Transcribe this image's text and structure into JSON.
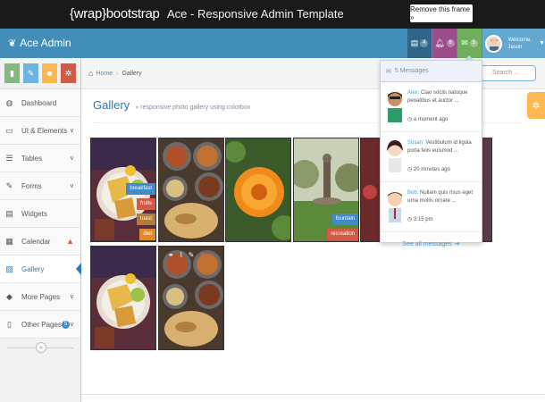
{
  "wrap_banner": {
    "logo": "{wrap}bootstrap",
    "title": "Ace - Responsive Admin Template",
    "remove_label": "Remove this frame »"
  },
  "navbar": {
    "brand": "Ace Admin",
    "tasks_count": "4",
    "notifications_count": "8",
    "messages_count": "5",
    "welcome": "Welcome,",
    "username": "Jason",
    "colors": {
      "bar": "#438eb9",
      "tasks": "#2e6589",
      "notifications": "#9b4d8c",
      "messages": "#6fae5c",
      "user": "#62a8d1"
    }
  },
  "shortcuts": [
    {
      "icon": "signal-icon",
      "color": "#87b87f"
    },
    {
      "icon": "pencil-icon",
      "color": "#6fb3e0"
    },
    {
      "icon": "users-icon",
      "color": "#ffb752"
    },
    {
      "icon": "cogs-icon",
      "color": "#d15b47"
    }
  ],
  "sidebar": {
    "items": [
      {
        "label": "Dashboard"
      },
      {
        "label": "UI & Elements"
      },
      {
        "label": "Tables"
      },
      {
        "label": "Forms"
      },
      {
        "label": "Widgets"
      },
      {
        "label": "Calendar"
      },
      {
        "label": "Gallery"
      },
      {
        "label": "More Pages"
      },
      {
        "label": "Other Pages",
        "badge": "5"
      }
    ]
  },
  "breadcrumb": {
    "home": "Home",
    "current": "Gallery",
    "search_placeholder": "Search ..."
  },
  "page": {
    "title": "Gallery",
    "subtitle": "» responsive photo gallery using colorbox"
  },
  "gallery": {
    "tags": {
      "t1": "breakfast",
      "t2": "fruits",
      "t3": "toast",
      "t4": "diet",
      "t5": "fountain",
      "t6": "recreation"
    }
  },
  "messages": {
    "header": "5 Messages",
    "items": [
      {
        "name": "Alex:",
        "text": "Ciao sociis natoque penatibus et auctor ...",
        "time": "a moment ago"
      },
      {
        "name": "Susan:",
        "text": "Vestibulum id ligula porta felis euismod ...",
        "time": "20 minutes ago"
      },
      {
        "name": "Bob:",
        "text": "Nullam quis risus eget urna mollis ornare ...",
        "time": "3:15 pm"
      }
    ],
    "see_all": "See all messages"
  }
}
